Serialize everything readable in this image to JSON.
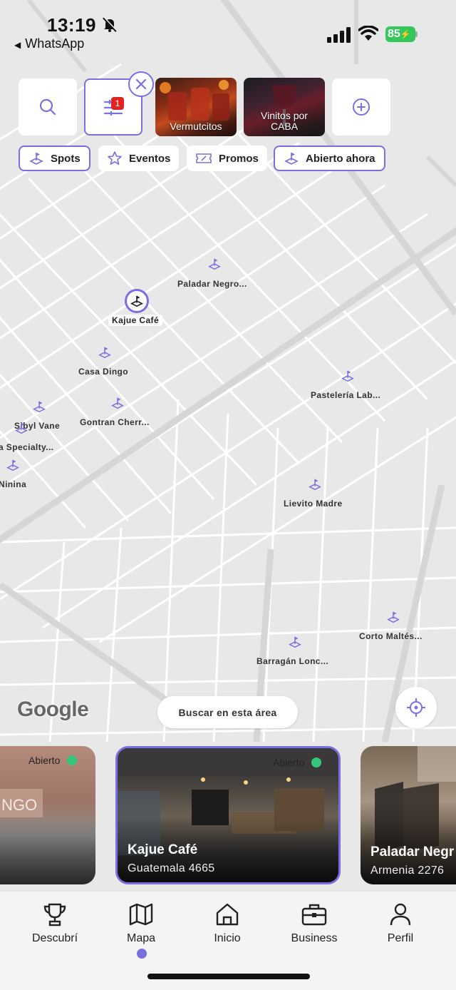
{
  "status_bar": {
    "time": "13:19",
    "back_app": "WhatsApp",
    "battery": "85"
  },
  "top_bar": {
    "filter_badge": "1",
    "stories": [
      {
        "label": "Vermutcitos"
      },
      {
        "label": "Vinitos por CABA"
      }
    ]
  },
  "chips": [
    {
      "label": "Spots",
      "icon": "spot-icon",
      "selected": true
    },
    {
      "label": "Eventos",
      "icon": "star-icon",
      "selected": false
    },
    {
      "label": "Promos",
      "icon": "ticket-icon",
      "selected": false
    },
    {
      "label": "Abierto ahora",
      "icon": "spot-icon",
      "selected": true
    }
  ],
  "map": {
    "pins": [
      {
        "label": "Paladar Negro..."
      },
      {
        "label": "Kajue Café",
        "selected": true
      },
      {
        "label": "Casa Dingo"
      },
      {
        "label": "Pastelería Lab..."
      },
      {
        "label": "Sibyl Vane"
      },
      {
        "label": "Gontran Cherr..."
      },
      {
        "label": "a Specialty..."
      },
      {
        "label": "Ninina"
      },
      {
        "label": "Lievito Madre"
      },
      {
        "label": "Corto Maltés..."
      },
      {
        "label": "Barragán Lonc..."
      }
    ],
    "attribution": "Google",
    "search_area_label": "Buscar en esta área"
  },
  "cards": [
    {
      "open_label": "Abierto",
      "name": "",
      "address": "",
      "sign_text": "NGO"
    },
    {
      "open_label": "Abierto",
      "name": "Kajue Café",
      "address": "Guatemala 4665"
    },
    {
      "open_label": "",
      "name": "Paladar Negr",
      "address": "Armenia 2276"
    }
  ],
  "bottom_nav": [
    {
      "label": "Descubrí",
      "icon": "trophy-icon"
    },
    {
      "label": "Mapa",
      "icon": "map-icon",
      "active": true
    },
    {
      "label": "Inicio",
      "icon": "home-icon"
    },
    {
      "label": "Business",
      "icon": "briefcase-icon"
    },
    {
      "label": "Perfil",
      "icon": "user-icon"
    }
  ],
  "colors": {
    "accent": "#7b6fe0",
    "open_dot": "#34c77b",
    "battery": "#34c759",
    "badge": "#e02424"
  }
}
